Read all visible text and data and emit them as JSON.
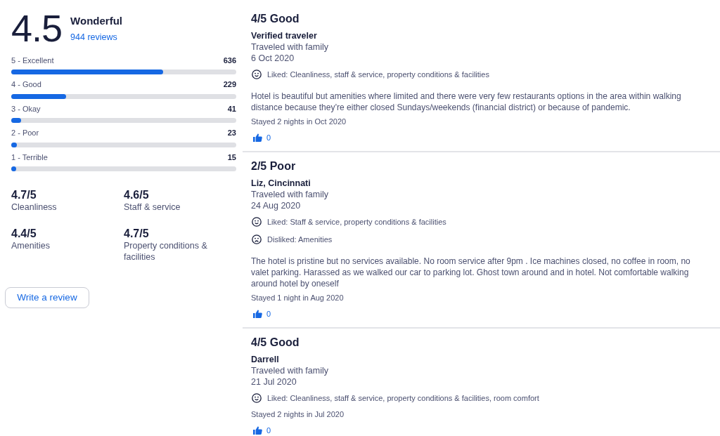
{
  "summary": {
    "score": "4.5",
    "rating_label": "Wonderful",
    "review_count": "944 reviews"
  },
  "distribution": [
    {
      "label": "5 - Excellent",
      "count": "636",
      "level": 0.674
    },
    {
      "label": "4 - Good",
      "count": "229",
      "level": 0.243
    },
    {
      "label": "3 - Okay",
      "count": "41",
      "level": 0.043
    },
    {
      "label": "2 - Poor",
      "count": "23",
      "level": 0.024
    },
    {
      "label": "1 - Terrible",
      "count": "15",
      "level": 0.016
    }
  ],
  "category_scores": [
    {
      "score": "4.7/5",
      "label": "Cleanliness"
    },
    {
      "score": "4.6/5",
      "label": "Staff & service"
    },
    {
      "score": "4.4/5",
      "label": "Amenities"
    },
    {
      "score": "4.7/5",
      "label": "Property conditions & facilities"
    }
  ],
  "write_review_button": "Write a review",
  "reviews": [
    {
      "rating": "4/5 Good",
      "author": "Verified traveler",
      "trip_type": "Traveled with family",
      "date": "6 Oct 2020",
      "feedback": [
        {
          "kind": "liked",
          "text": "Liked: Cleanliness, staff & service, property conditions & facilities"
        }
      ],
      "text": "Hotel is beautiful but amenities where limited and there were very few restaurants options in the area within walking distance because they’re either closed Sundays/weekends (financial district) or because of pandemic.",
      "stay": "Stayed 2 nights in Oct 2020",
      "helpful_count": "0"
    },
    {
      "rating": "2/5 Poor",
      "author": "Liz, Cincinnati",
      "trip_type": "Traveled with family",
      "date": "24 Aug 2020",
      "feedback": [
        {
          "kind": "liked",
          "text": "Liked: Staff & service, property conditions & facilities"
        },
        {
          "kind": "disliked",
          "text": "Disliked: Amenities"
        }
      ],
      "text": "The hotel is pristine but no services available. No room service after 9pm . Ice machines closed, no coffee in room, no valet parking. Harassed as we walked our car to parking lot. Ghost town around and in hotel. Not comfortable walking around hotel by oneself",
      "stay": "Stayed 1 night in Aug 2020",
      "helpful_count": "0"
    },
    {
      "rating": "4/5 Good",
      "author": "Darrell",
      "trip_type": "Traveled with family",
      "date": "21 Jul 2020",
      "feedback": [
        {
          "kind": "liked",
          "text": "Liked: Cleanliness, staff & service, property conditions & facilities, room comfort"
        }
      ],
      "stay": "Stayed 2 nights in Jul 2020",
      "helpful_count": "0"
    }
  ]
}
